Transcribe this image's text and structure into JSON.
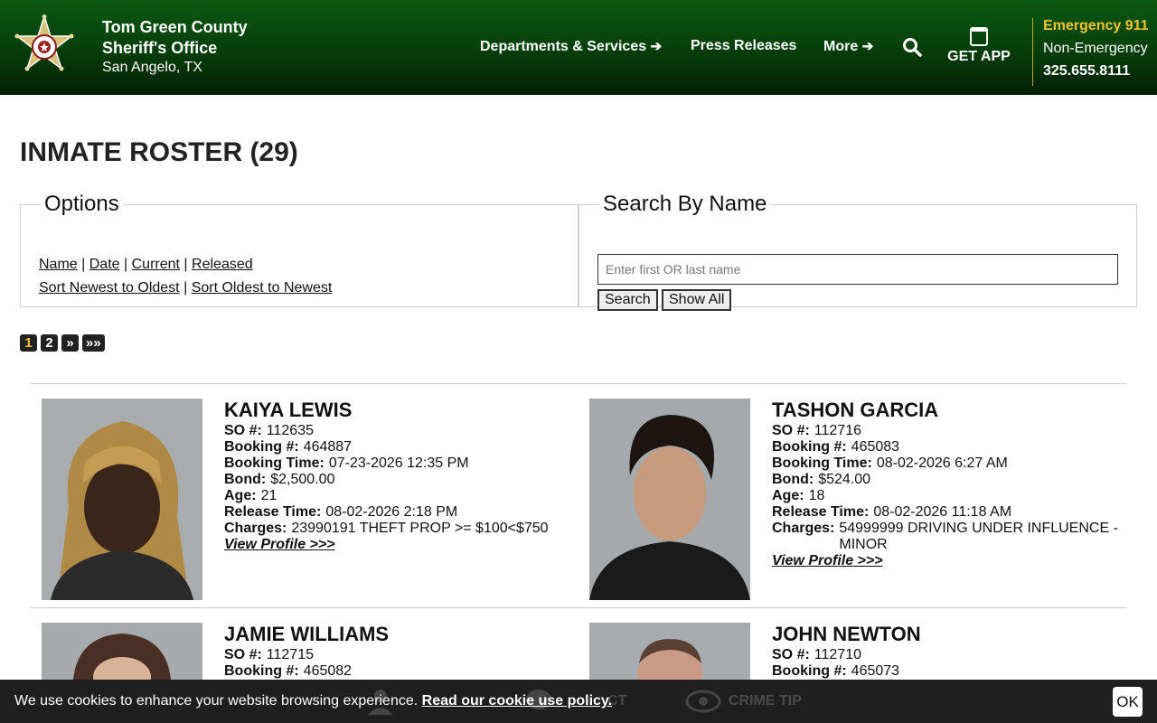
{
  "header": {
    "org_line1": "Tom Green County",
    "org_line2": "Sheriff's Office",
    "location": "San Angelo, TX",
    "nav": [
      {
        "label": "Departments & Services",
        "has_arrow": true
      },
      {
        "label": "Press Releases",
        "has_arrow": false
      },
      {
        "label": "More",
        "has_arrow": true
      }
    ],
    "search_icon": "search-icon",
    "get_app_label": "GET APP",
    "emergency_label": "Emergency 911",
    "non_emergency_label": "Non-Emergency",
    "non_emergency_phone": "325.655.8111",
    "colors": {
      "header_green": "#063d0a",
      "accent_gold": "#f1c232"
    }
  },
  "page": {
    "title": "INMATE ROSTER (29)"
  },
  "options": {
    "legend": "Options",
    "filters": [
      "Name",
      "Date",
      "Current",
      "Released"
    ],
    "sorts": [
      "Sort Newest to Oldest",
      "Sort Oldest to Newest"
    ],
    "separator": "|"
  },
  "search": {
    "legend": "Search By Name",
    "placeholder": "Enter first OR last name",
    "value": "",
    "search_button": "Search",
    "show_all_button": "Show All"
  },
  "pagination": {
    "pages": [
      "1",
      "2",
      "»",
      "»»"
    ],
    "current": "1"
  },
  "labels": {
    "so": "SO #:",
    "booking": "Booking #:",
    "booking_time": "Booking Time:",
    "bond": "Bond:",
    "age": "Age:",
    "release_time": "Release Time:",
    "charges": "Charges:",
    "view_profile": "View Profile >>>"
  },
  "inmates": [
    {
      "name": "KAIYA LEWIS",
      "so": "112635",
      "booking": "464887",
      "booking_time": "07-23-2026 12:35 PM",
      "bond": "$2,500.00",
      "age": "21",
      "release_time": "08-02-2026 2:18 PM",
      "charges": "23990191 THEFT PROP >= $100<$750"
    },
    {
      "name": "TASHON GARCIA",
      "so": "112716",
      "booking": "465083",
      "booking_time": "08-02-2026 6:27 AM",
      "bond": "$524.00",
      "age": "18",
      "release_time": "08-02-2026 11:18 AM",
      "charges": "54999999 DRIVING UNDER INFLUENCE -MINOR"
    },
    {
      "name": "JAMIE WILLIAMS",
      "so": "112715",
      "booking": "465082"
    },
    {
      "name": "JOHN NEWTON",
      "so": "112710",
      "booking": "465073"
    }
  ],
  "cookie": {
    "message": "We use cookies to enhance your website browsing experience.",
    "link_text": "Read our cookie use policy.",
    "ok_label": "OK",
    "behind_bar": [
      "CT",
      "CRIME TIP"
    ]
  }
}
